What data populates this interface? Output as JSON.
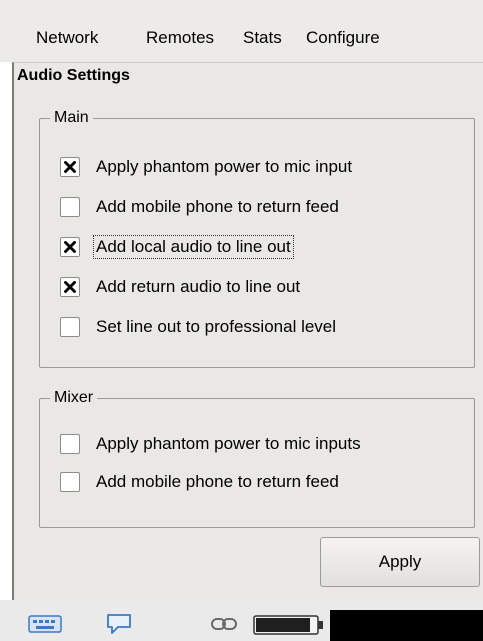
{
  "menu": [
    {
      "label": "Network"
    },
    {
      "label": "Remotes"
    },
    {
      "label": "Stats"
    },
    {
      "label": "Configure"
    }
  ],
  "panel": {
    "title": "Audio Settings"
  },
  "main_group": {
    "legend": "Main",
    "options": [
      {
        "label": "Apply phantom power to mic input",
        "checked": true
      },
      {
        "label": "Add mobile phone to return feed",
        "checked": false
      },
      {
        "label": "Add local audio to line out",
        "checked": true,
        "focused": true
      },
      {
        "label": "Add return audio to line out",
        "checked": true
      },
      {
        "label": "Set line out to professional level",
        "checked": false
      }
    ]
  },
  "mixer_group": {
    "legend": "Mixer",
    "options": [
      {
        "label": "Apply phantom power to mic inputs",
        "checked": false
      },
      {
        "label": "Add mobile phone to return feed",
        "checked": false
      }
    ]
  },
  "apply_button": {
    "label": "Apply"
  },
  "statusbar": {
    "icons": [
      "keyboard-icon",
      "chat-bubble-icon",
      "link-icon",
      "battery-icon"
    ],
    "battery_level": 0.9
  },
  "colors": {
    "panel_bg": "#e9e8e4",
    "menubar_bg": "#ecebe8",
    "status_icon_blue": "#3a78c8"
  }
}
